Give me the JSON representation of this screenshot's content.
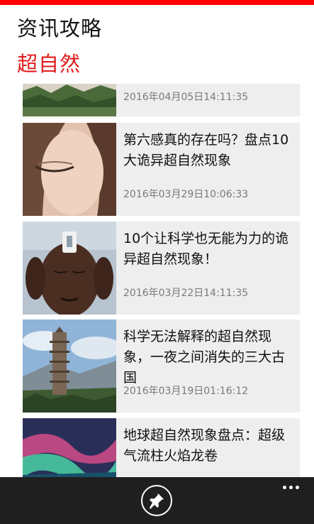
{
  "header": {
    "app_title": "资讯攻略",
    "section_title": "超自然",
    "accent_color": "#ff0000",
    "section_color": "#e31c1c"
  },
  "articles": [
    {
      "title": "",
      "date": "2016年04月05日14:11:35",
      "thumb_icon": "mountain-landscape-image"
    },
    {
      "title": "第六感真的存在吗？盘点10大诡异超自然现象",
      "date": "2016年03月29日10:06:33",
      "thumb_icon": "closed-eye-face-image"
    },
    {
      "title": "10个让科学也无能为力的诡异超自然现象！",
      "date": "2016年03月22日14:11:35",
      "thumb_icon": "meditating-man-image"
    },
    {
      "title": "科学无法解释的超自然现象，一夜之间消失的三大古国",
      "date": "2016年03月19日01:16:12",
      "thumb_icon": "pagoda-image"
    },
    {
      "title": "地球超自然现象盘点：超级气流柱火焰龙卷",
      "date": "",
      "thumb_icon": "aurora-image"
    }
  ],
  "app_bar": {
    "background": "#1f1f1f",
    "pin_icon": "pin-icon",
    "more_icon": "more-dots-icon"
  }
}
